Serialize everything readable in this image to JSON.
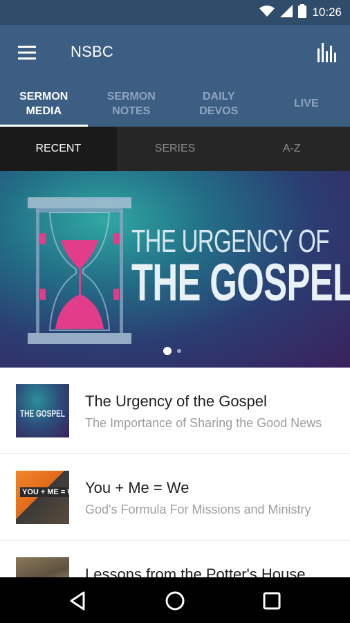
{
  "status_bar": {
    "time": "10:26"
  },
  "app_bar": {
    "title": "NSBC"
  },
  "tabs": [
    {
      "label": "SERMON\nMEDIA",
      "active": true
    },
    {
      "label": "SERMON\nNOTES",
      "active": false
    },
    {
      "label": "DAILY\nDEVOS",
      "active": false
    },
    {
      "label": "LIVE",
      "active": false
    }
  ],
  "subtabs": [
    {
      "label": "RECENT",
      "active": true
    },
    {
      "label": "SERIES",
      "active": false
    },
    {
      "label": "A-Z",
      "active": false
    }
  ],
  "banner": {
    "line1": "THE URGENCY OF",
    "line2": "THE GOSPEL",
    "page_index": 1,
    "page_count": 2
  },
  "sermons": [
    {
      "title": "The Urgency of the Gospel",
      "subtitle": "The Importance of Sharing the Good News",
      "thumb_text": "THE GOSPEL"
    },
    {
      "title": "You + Me = We",
      "subtitle": "God's Formula For Missions and Ministry",
      "thumb_text": "YOU + ME = WE"
    },
    {
      "title": "Lessons from the Potter's House",
      "subtitle": "",
      "thumb_text": ""
    }
  ],
  "colors": {
    "status_bar": "#2f4c6a",
    "app_bar": "#3b5e82",
    "subtab_bar": "#262626",
    "accent_pink": "#e23d8a"
  }
}
